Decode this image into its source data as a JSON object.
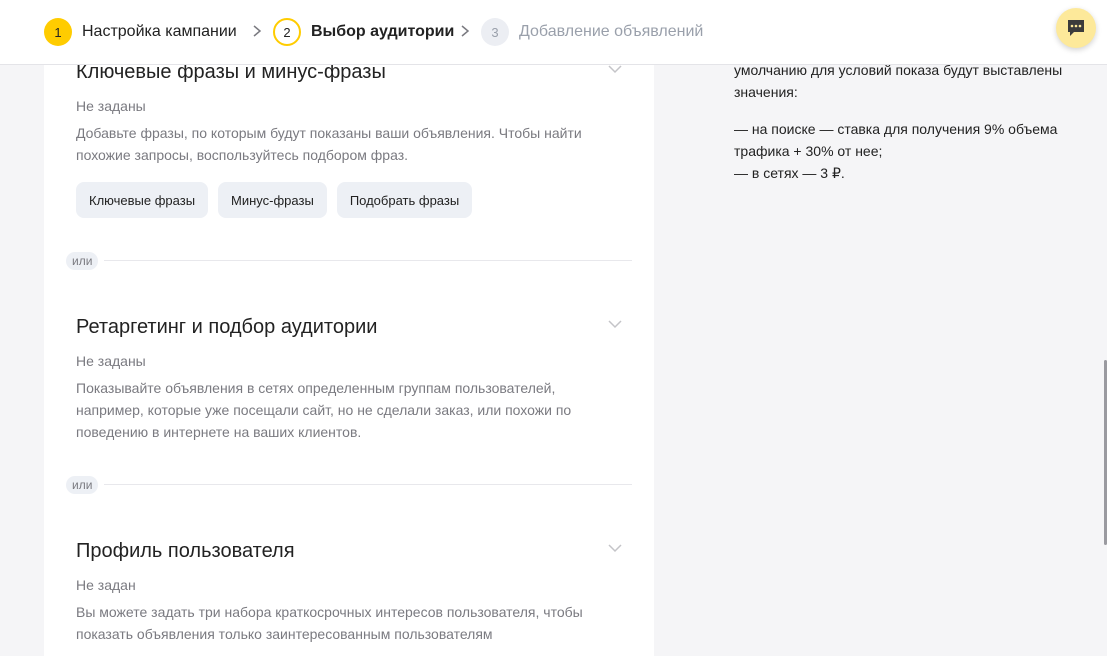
{
  "stepper": {
    "steps": [
      {
        "num": "1",
        "label": "Настройка кампании",
        "state": "done"
      },
      {
        "num": "2",
        "label": "Выбор аудитории",
        "state": "active"
      },
      {
        "num": "3",
        "label": "Добавление объявлений",
        "state": "future"
      }
    ]
  },
  "chat": {
    "icon": "chat-icon"
  },
  "sections": [
    {
      "title": "Ключевые фразы и минус-фразы",
      "status": "Не заданы",
      "desc_lines": [
        "Добавьте фразы, по которым будут показаны ваши объявления. Чтобы найти",
        "похожие запросы, воспользуйтесь подбором фраз."
      ],
      "buttons": [
        "Ключевые фразы",
        "Минус-фразы",
        "Подобрать фразы"
      ]
    },
    {
      "title": "Ретаргетинг и подбор аудитории",
      "status": "Не заданы",
      "desc_lines": [
        "Показывайте объявления в сетях определенным группам пользователей,",
        "например, которые уже посещали сайт, но не сделали заказ, или похожи по",
        "поведению в интернете на ваших клиентов."
      ]
    },
    {
      "title": "Профиль пользователя",
      "status": "Не задан",
      "desc_lines": [
        "Вы можете задать три набора краткосрочных интересов пользователя, чтобы",
        "показать объявления только заинтересованным пользователям"
      ]
    }
  ],
  "divider_label": "или",
  "side_info": {
    "lines": [
      "умолчанию для условий показа будут выставлены",
      "значения:"
    ],
    "items": [
      "—   на поиске — ставка для получения 9% объема",
      "трафика + 30% от нее;",
      "—   в сетях — 3 ₽."
    ]
  },
  "colors": {
    "accent": "#ffcc00",
    "muted_text": "#7a7a80",
    "button_bg": "#edf0f5"
  }
}
